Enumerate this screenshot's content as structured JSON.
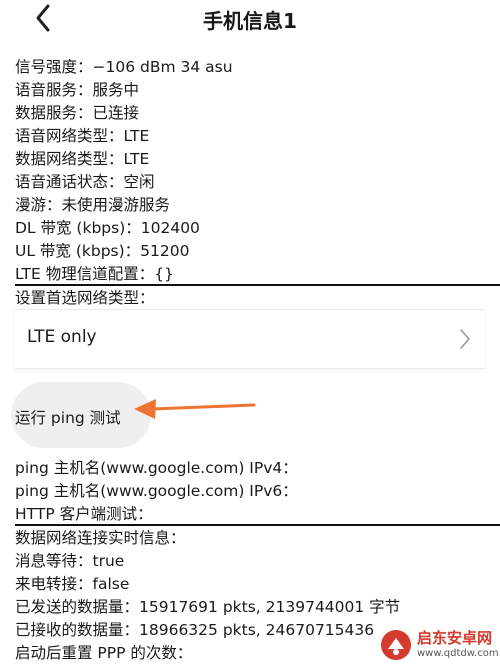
{
  "header": {
    "title": "手机信息1"
  },
  "info_lines": [
    "信号强度：−106 dBm   34 asu",
    "语音服务：服务中",
    "数据服务：已连接",
    "语音网络类型：LTE",
    "数据网络类型：LTE",
    "语音通话状态：空闲",
    "漫游：未使用漫游服务",
    "DL 带宽 (kbps)：102400",
    "UL 带宽 (kbps)：51200",
    "LTE 物理信道配置：{}"
  ],
  "preferred_network": {
    "label": "设置首选网络类型：",
    "value": "LTE only"
  },
  "ping": {
    "button_label": "运行 ping 测试",
    "ipv4": "ping 主机名(www.google.com) IPv4：",
    "ipv6": "ping 主机名(www.google.com) IPv6：",
    "http": "HTTP 客户端测试："
  },
  "data_info": {
    "header": "数据网络连接实时信息：",
    "lines": [
      "消息等待：true",
      "来电转接：false",
      "已发送的数据量：15917691 pkts, 2139744001 字节",
      "已接收的数据量：18966325 pkts, 24670715436",
      "启动后重置 PPP 的次数："
    ]
  },
  "watermark": {
    "name": "启东安卓网",
    "url": "www.qdtdw.com"
  },
  "colors": {
    "arrow": "#ee7434",
    "watermark_red": "#d23b2e"
  }
}
